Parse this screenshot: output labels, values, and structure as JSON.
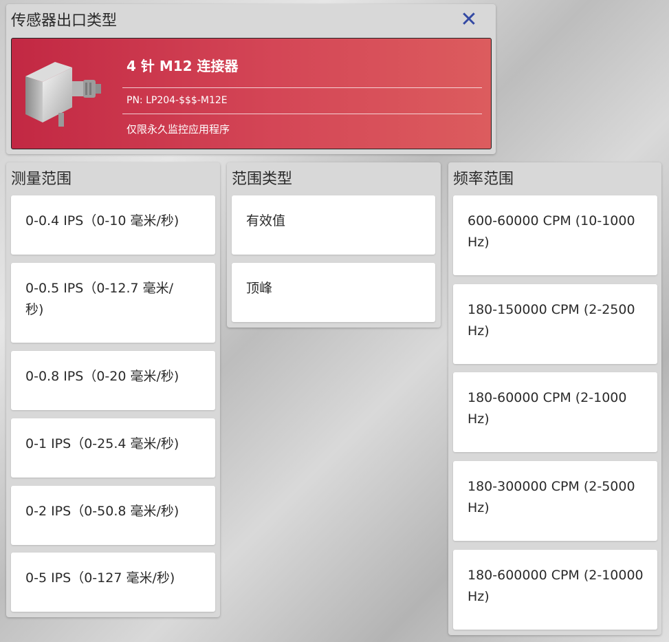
{
  "sensor_panel": {
    "title": "传感器出口类型",
    "close_icon": "close-icon",
    "connector": {
      "title": "4 针 M12 连接器",
      "pn": "PN: LP204-$$$-M12E",
      "note": "仅限永久监控应用程序",
      "background": "#c22843"
    }
  },
  "measure_range": {
    "title": "测量范围",
    "options": [
      "0-0.4 IPS（0-10 毫米/秒)",
      "0-0.5 IPS（0-12.7 毫米/秒)",
      "0-0.8 IPS（0-20 毫米/秒)",
      "0-1 IPS（0-25.4 毫米/秒)",
      "0-2 IPS（0-50.8 毫米/秒)",
      "0-5 IPS（0-127 毫米/秒)"
    ]
  },
  "range_type": {
    "title": "范围类型",
    "options": [
      "有效值",
      "顶峰"
    ]
  },
  "freq_range": {
    "title": "频率范围",
    "options": [
      "600-60000 CPM (10-1000 Hz)",
      "180-150000 CPM (2-2500 Hz)",
      "180-60000 CPM (2-1000 Hz)",
      "180-300000 CPM (2-5000 Hz)",
      "180-600000 CPM (2-10000 Hz)"
    ]
  },
  "colors": {
    "accent": "#3349a3",
    "card_red": "#d44656",
    "panel_bg": "#d8d8d8"
  }
}
